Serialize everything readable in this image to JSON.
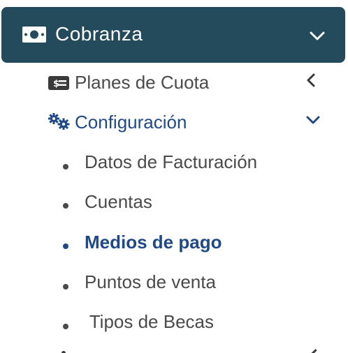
{
  "menu": {
    "header": {
      "label": "Cobranza",
      "icon": "money-bill-icon",
      "chevron": "chevron-down-icon"
    },
    "planes": {
      "label": "Planes de Cuota",
      "icon": "dollar-card-icon",
      "chevron": "chevron-left-icon"
    },
    "config": {
      "label": "Configuración",
      "icon": "cogs-icon",
      "chevron": "chevron-down-icon"
    },
    "sub_items": [
      {
        "label": "Datos de Facturación",
        "active": false
      },
      {
        "label": "Cuentas",
        "active": false
      },
      {
        "label": "Medios de pago",
        "active": true
      },
      {
        "label": "Puntos de venta",
        "active": false
      },
      {
        "label": " Tipos de Becas",
        "active": false
      }
    ]
  },
  "colors": {
    "header_bg": "#234b5c",
    "active_text": "#1e4a8a",
    "normal_text": "#4a4a4a"
  }
}
